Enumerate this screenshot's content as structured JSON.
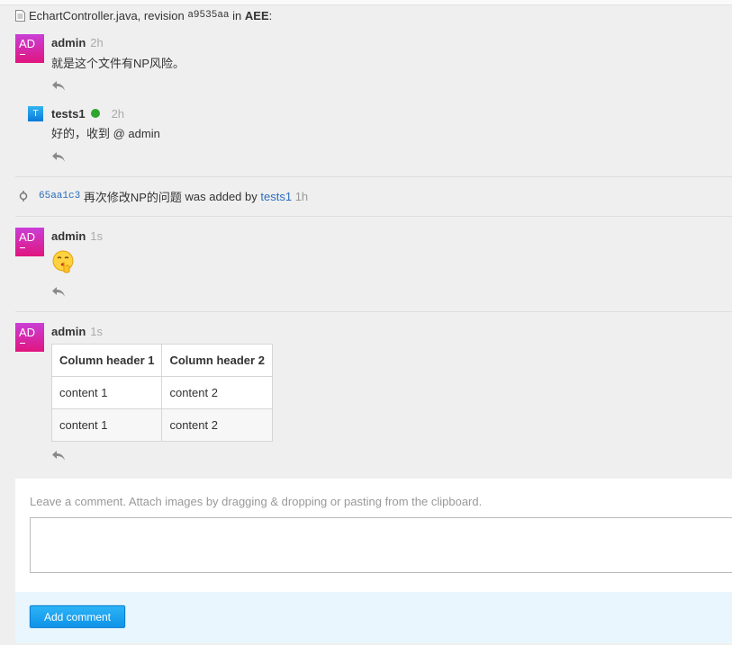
{
  "header": {
    "file": "EchartController.java",
    "revision_word": ", revision",
    "revision": "a9535aa",
    "in_word": "in",
    "project": "AEE",
    "colon": ":"
  },
  "comments": [
    {
      "avatar": "AD",
      "author": "admin",
      "time": "2h",
      "text": "就是这个文件有NP风险。"
    },
    {
      "avatar": "T",
      "author": "tests1",
      "time": "2h",
      "text": "好的，收到 @ admin",
      "online": true
    },
    {
      "avatar": "AD",
      "author": "admin",
      "time": "1s",
      "emoji": "shh-emoji"
    },
    {
      "avatar": "AD",
      "author": "admin",
      "time": "1s",
      "table": {
        "headers": [
          "Column header 1",
          "Column header 2"
        ],
        "rows": [
          [
            "content 1",
            "content 2"
          ],
          [
            "content 1",
            "content 2"
          ]
        ]
      }
    }
  ],
  "system_event": {
    "commit": "65aa1c3",
    "message": "再次修改NP的问题",
    "added_by": "was added by",
    "user": "tests1",
    "time": "1h"
  },
  "form": {
    "hint": "Leave a comment. Attach images by dragging & dropping or pasting from the clipboard.",
    "textarea_value": "",
    "submit_label": "Add comment"
  },
  "icons": [
    "file-icon",
    "reply-icon",
    "commit-icon",
    "online-dot"
  ],
  "colors": {
    "accent": "#1a9ff0",
    "avatar": "#d62fa0",
    "link": "#2a6ebb",
    "online": "#2fa52f"
  }
}
